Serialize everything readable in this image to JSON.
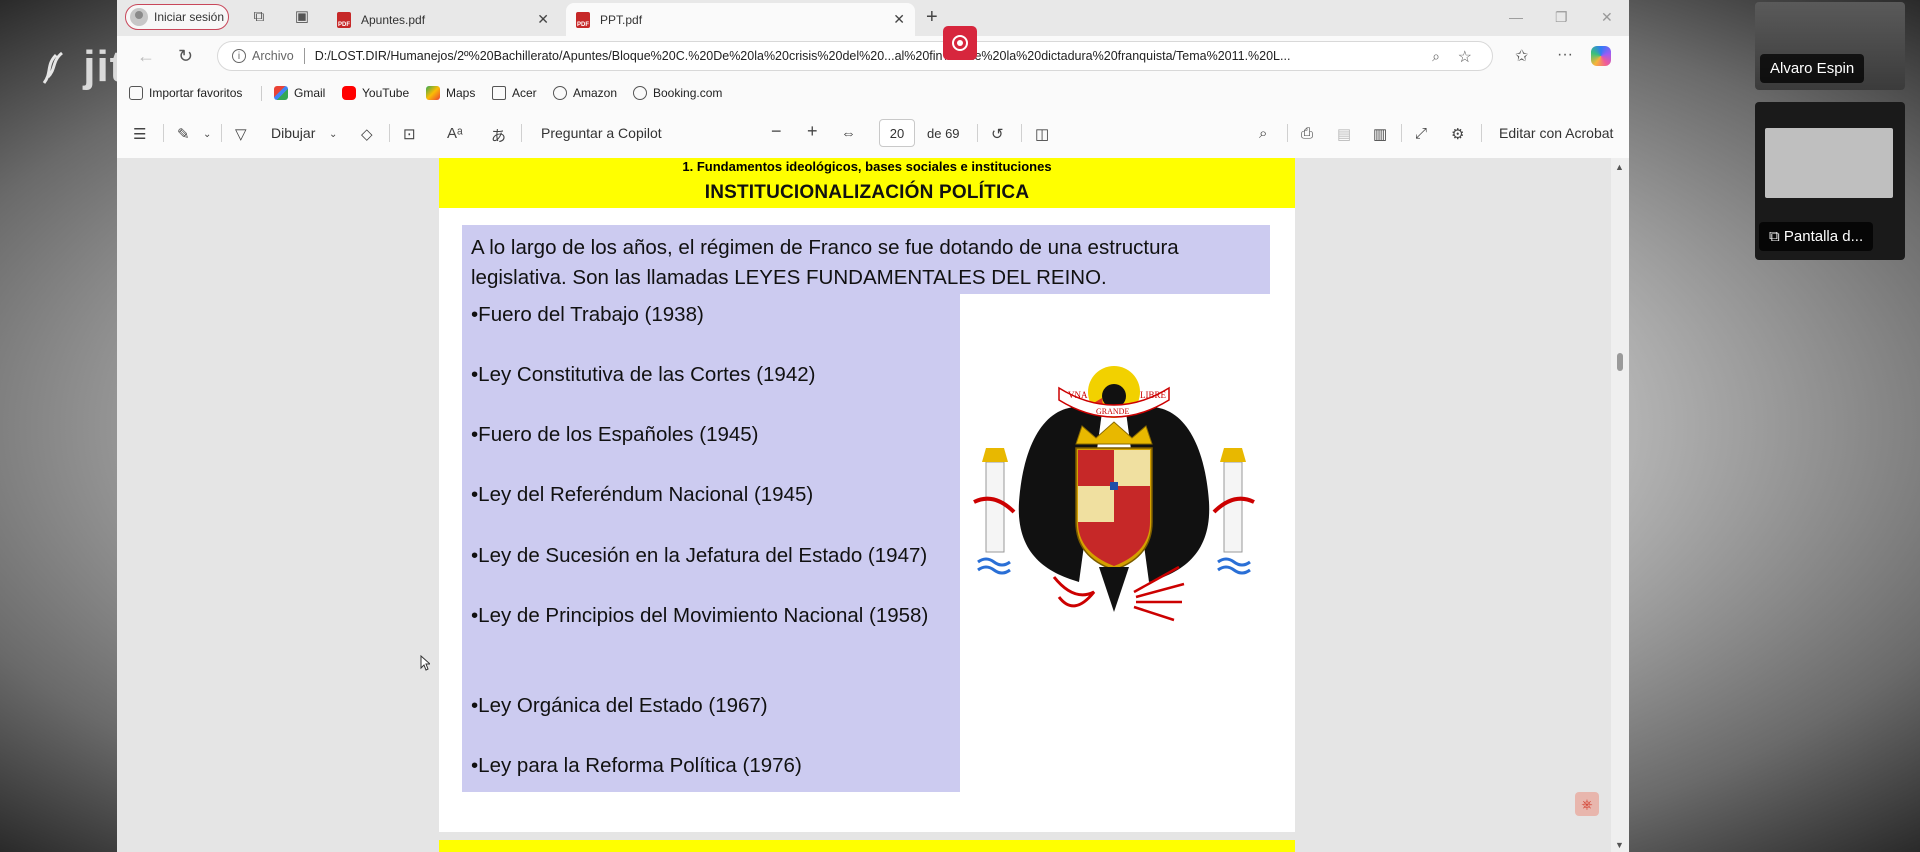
{
  "meeting": {
    "logo": "jitsi",
    "participants": [
      {
        "name": "Alvaro Espin"
      },
      {
        "name": "Pantalla d..."
      }
    ]
  },
  "browser": {
    "profile_label": "Iniciar sesión",
    "tabs": [
      {
        "title": "Apuntes.pdf",
        "icon": "pdf-icon",
        "active": false
      },
      {
        "title": "PPT.pdf",
        "icon": "pdf-icon",
        "active": true
      }
    ],
    "address": {
      "scheme_label": "Archivo",
      "url": "D:/LOST.DIR/Humanejos/2º%20Bachillerato/Apuntes/Bloque%20C.%20De%20la%20crisis%20del%20...al%20fin%20de%20la%20dictadura%20franquista/Tema%2011.%20L..."
    },
    "favorites": [
      {
        "label": "Importar favoritos",
        "icon": "import-icon"
      },
      {
        "label": "Gmail",
        "icon": "gmail-icon"
      },
      {
        "label": "YouTube",
        "icon": "youtube-icon"
      },
      {
        "label": "Maps",
        "icon": "maps-icon"
      },
      {
        "label": "Acer",
        "icon": "folder-icon"
      },
      {
        "label": "Amazon",
        "icon": "globe-icon"
      },
      {
        "label": "Booking.com",
        "icon": "globe-icon"
      }
    ]
  },
  "pdf_toolbar": {
    "draw_label": "Dibujar",
    "copilot_label": "Preguntar a Copilot",
    "page_current": "20",
    "page_total": "de 69",
    "acrobat_label": "Editar con Acrobat"
  },
  "slide": {
    "subtitle": "1. Fundamentos ideológicos, bases sociales e instituciones",
    "title": "INSTITUCIONALIZACIÓN POLÍTICA",
    "intro": "A lo largo de los años, el régimen de Franco se fue dotando de una estructura legislativa. Son las llamadas LEYES FUNDAMENTALES DEL REINO.",
    "laws": [
      "•Fuero del Trabajo (1938)",
      "•Ley Constitutiva de las Cortes (1942)",
      "•Fuero de los Españoles (1945)",
      "•Ley del Referéndum Nacional (1945)",
      "•Ley de Sucesión en la Jefatura del Estado (1947)",
      "•Ley de Principios del Movimiento Nacional (1958)",
      "•Ley Orgánica del Estado (1967)",
      "•Ley para la Reforma Política (1976)"
    ],
    "emblem": {
      "banner_left": "VNA",
      "banner_center": "GRANDE",
      "banner_right": "LIBRE"
    }
  },
  "colors": {
    "slide_header": "#ffff00",
    "slide_box": "#cccbf0",
    "record": "#d7263d"
  }
}
